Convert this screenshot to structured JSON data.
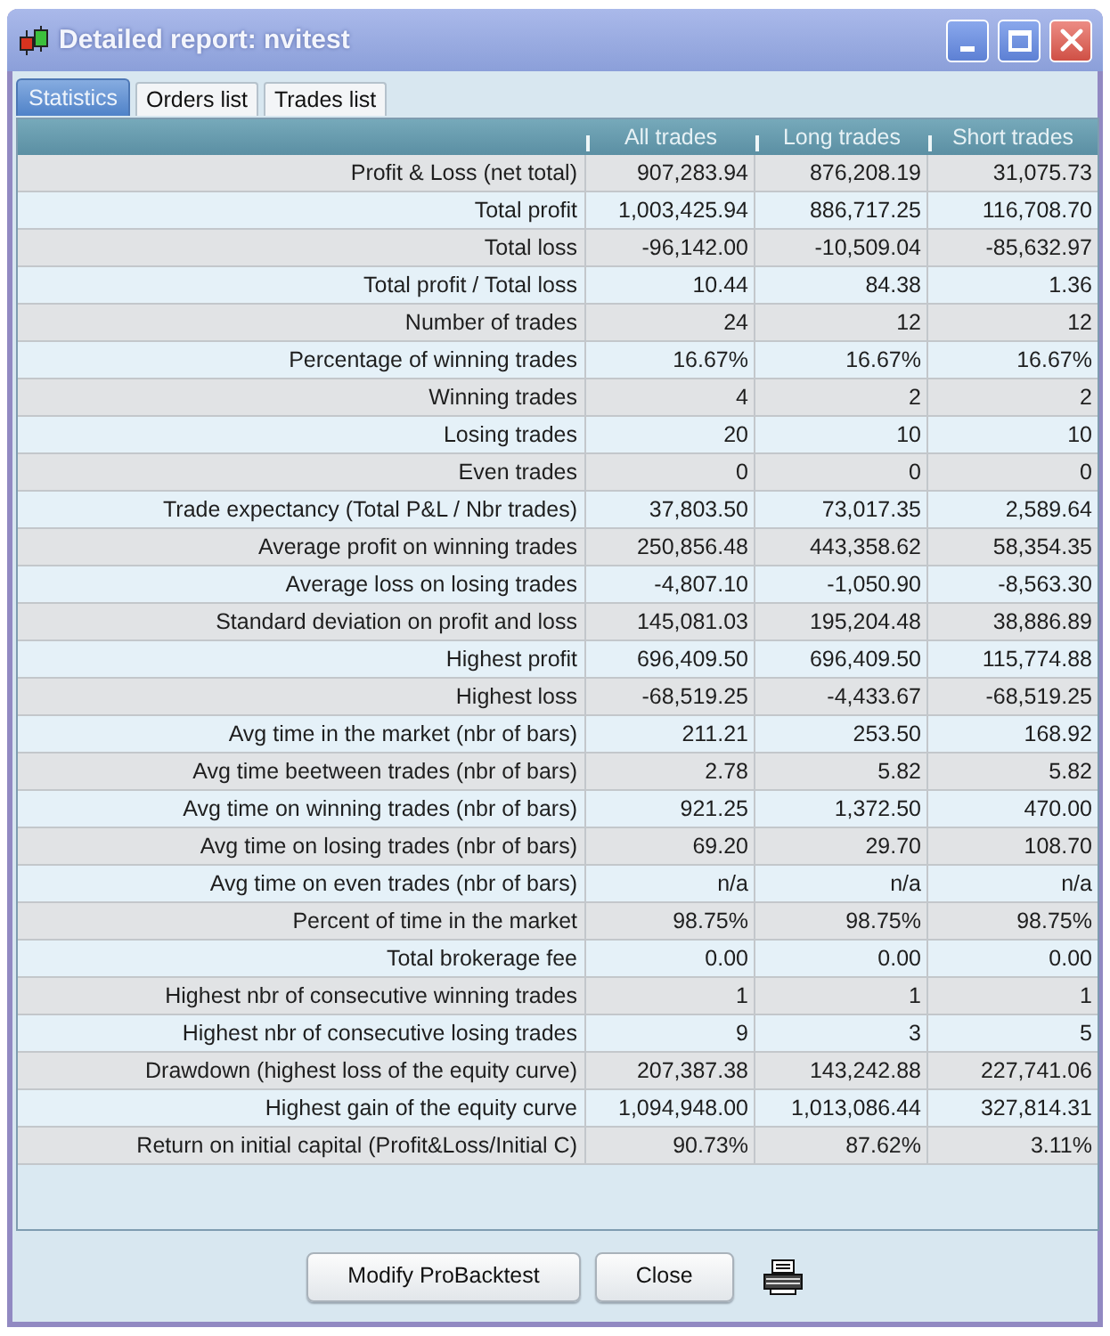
{
  "window": {
    "title": "Detailed report: nvitest"
  },
  "tabs": [
    {
      "label": "Statistics",
      "selected": true
    },
    {
      "label": "Orders list",
      "selected": false
    },
    {
      "label": "Trades list",
      "selected": false
    }
  ],
  "table": {
    "columns": [
      "All trades",
      "Long trades",
      "Short trades"
    ],
    "rows": [
      {
        "label": "Profit & Loss (net total)",
        "values": [
          "907,283.94",
          "876,208.19",
          "31,075.73"
        ]
      },
      {
        "label": "Total profit",
        "values": [
          "1,003,425.94",
          "886,717.25",
          "116,708.70"
        ]
      },
      {
        "label": "Total loss",
        "values": [
          "-96,142.00",
          "-10,509.04",
          "-85,632.97"
        ]
      },
      {
        "label": "Total profit / Total loss",
        "values": [
          "10.44",
          "84.38",
          "1.36"
        ]
      },
      {
        "label": "Number of trades",
        "values": [
          "24",
          "12",
          "12"
        ]
      },
      {
        "label": "Percentage of winning trades",
        "values": [
          "16.67%",
          "16.67%",
          "16.67%"
        ]
      },
      {
        "label": "Winning trades",
        "values": [
          "4",
          "2",
          "2"
        ]
      },
      {
        "label": "Losing trades",
        "values": [
          "20",
          "10",
          "10"
        ]
      },
      {
        "label": "Even trades",
        "values": [
          "0",
          "0",
          "0"
        ]
      },
      {
        "label": "Trade expectancy (Total P&L / Nbr trades)",
        "values": [
          "37,803.50",
          "73,017.35",
          "2,589.64"
        ]
      },
      {
        "label": "Average profit on winning trades",
        "values": [
          "250,856.48",
          "443,358.62",
          "58,354.35"
        ]
      },
      {
        "label": "Average loss on losing trades",
        "values": [
          "-4,807.10",
          "-1,050.90",
          "-8,563.30"
        ]
      },
      {
        "label": "Standard deviation on profit and loss",
        "values": [
          "145,081.03",
          "195,204.48",
          "38,886.89"
        ]
      },
      {
        "label": "Highest profit",
        "values": [
          "696,409.50",
          "696,409.50",
          "115,774.88"
        ]
      },
      {
        "label": "Highest loss",
        "values": [
          "-68,519.25",
          "-4,433.67",
          "-68,519.25"
        ]
      },
      {
        "label": "Avg time in the market (nbr of bars)",
        "values": [
          "211.21",
          "253.50",
          "168.92"
        ]
      },
      {
        "label": "Avg time beetween trades (nbr of bars)",
        "values": [
          "2.78",
          "5.82",
          "5.82"
        ]
      },
      {
        "label": "Avg time on winning trades (nbr of bars)",
        "values": [
          "921.25",
          "1,372.50",
          "470.00"
        ]
      },
      {
        "label": "Avg time on losing trades (nbr of bars)",
        "values": [
          "69.20",
          "29.70",
          "108.70"
        ]
      },
      {
        "label": "Avg time on even trades (nbr of bars)",
        "values": [
          "n/a",
          "n/a",
          "n/a"
        ]
      },
      {
        "label": "Percent of time in the market",
        "values": [
          "98.75%",
          "98.75%",
          "98.75%"
        ]
      },
      {
        "label": "Total brokerage fee",
        "values": [
          "0.00",
          "0.00",
          "0.00"
        ]
      },
      {
        "label": "Highest nbr of consecutive winning trades",
        "values": [
          "1",
          "1",
          "1"
        ]
      },
      {
        "label": "Highest nbr of consecutive losing trades",
        "values": [
          "9",
          "3",
          "5"
        ]
      },
      {
        "label": "Drawdown (highest loss of the equity curve)",
        "values": [
          "207,387.38",
          "143,242.88",
          "227,741.06"
        ]
      },
      {
        "label": "Highest gain of the equity curve",
        "values": [
          "1,094,948.00",
          "1,013,086.44",
          "327,814.31"
        ]
      },
      {
        "label": "Return on initial capital (Profit&Loss/Initial C)",
        "values": [
          "90.73%",
          "87.62%",
          "3.11%"
        ]
      }
    ]
  },
  "buttons": [
    "Modify ProBacktest",
    "Close"
  ]
}
